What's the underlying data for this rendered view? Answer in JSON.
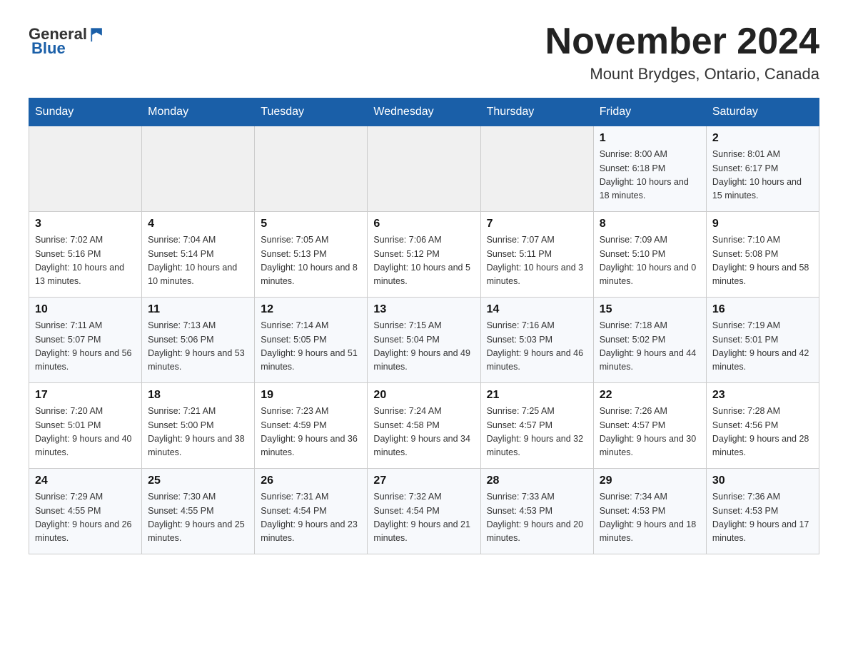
{
  "header": {
    "logo_general": "General",
    "logo_blue": "Blue",
    "title": "November 2024",
    "subtitle": "Mount Brydges, Ontario, Canada"
  },
  "weekdays": [
    "Sunday",
    "Monday",
    "Tuesday",
    "Wednesday",
    "Thursday",
    "Friday",
    "Saturday"
  ],
  "weeks": [
    [
      {
        "day": "",
        "sunrise": "",
        "sunset": "",
        "daylight": ""
      },
      {
        "day": "",
        "sunrise": "",
        "sunset": "",
        "daylight": ""
      },
      {
        "day": "",
        "sunrise": "",
        "sunset": "",
        "daylight": ""
      },
      {
        "day": "",
        "sunrise": "",
        "sunset": "",
        "daylight": ""
      },
      {
        "day": "",
        "sunrise": "",
        "sunset": "",
        "daylight": ""
      },
      {
        "day": "1",
        "sunrise": "Sunrise: 8:00 AM",
        "sunset": "Sunset: 6:18 PM",
        "daylight": "Daylight: 10 hours and 18 minutes."
      },
      {
        "day": "2",
        "sunrise": "Sunrise: 8:01 AM",
        "sunset": "Sunset: 6:17 PM",
        "daylight": "Daylight: 10 hours and 15 minutes."
      }
    ],
    [
      {
        "day": "3",
        "sunrise": "Sunrise: 7:02 AM",
        "sunset": "Sunset: 5:16 PM",
        "daylight": "Daylight: 10 hours and 13 minutes."
      },
      {
        "day": "4",
        "sunrise": "Sunrise: 7:04 AM",
        "sunset": "Sunset: 5:14 PM",
        "daylight": "Daylight: 10 hours and 10 minutes."
      },
      {
        "day": "5",
        "sunrise": "Sunrise: 7:05 AM",
        "sunset": "Sunset: 5:13 PM",
        "daylight": "Daylight: 10 hours and 8 minutes."
      },
      {
        "day": "6",
        "sunrise": "Sunrise: 7:06 AM",
        "sunset": "Sunset: 5:12 PM",
        "daylight": "Daylight: 10 hours and 5 minutes."
      },
      {
        "day": "7",
        "sunrise": "Sunrise: 7:07 AM",
        "sunset": "Sunset: 5:11 PM",
        "daylight": "Daylight: 10 hours and 3 minutes."
      },
      {
        "day": "8",
        "sunrise": "Sunrise: 7:09 AM",
        "sunset": "Sunset: 5:10 PM",
        "daylight": "Daylight: 10 hours and 0 minutes."
      },
      {
        "day": "9",
        "sunrise": "Sunrise: 7:10 AM",
        "sunset": "Sunset: 5:08 PM",
        "daylight": "Daylight: 9 hours and 58 minutes."
      }
    ],
    [
      {
        "day": "10",
        "sunrise": "Sunrise: 7:11 AM",
        "sunset": "Sunset: 5:07 PM",
        "daylight": "Daylight: 9 hours and 56 minutes."
      },
      {
        "day": "11",
        "sunrise": "Sunrise: 7:13 AM",
        "sunset": "Sunset: 5:06 PM",
        "daylight": "Daylight: 9 hours and 53 minutes."
      },
      {
        "day": "12",
        "sunrise": "Sunrise: 7:14 AM",
        "sunset": "Sunset: 5:05 PM",
        "daylight": "Daylight: 9 hours and 51 minutes."
      },
      {
        "day": "13",
        "sunrise": "Sunrise: 7:15 AM",
        "sunset": "Sunset: 5:04 PM",
        "daylight": "Daylight: 9 hours and 49 minutes."
      },
      {
        "day": "14",
        "sunrise": "Sunrise: 7:16 AM",
        "sunset": "Sunset: 5:03 PM",
        "daylight": "Daylight: 9 hours and 46 minutes."
      },
      {
        "day": "15",
        "sunrise": "Sunrise: 7:18 AM",
        "sunset": "Sunset: 5:02 PM",
        "daylight": "Daylight: 9 hours and 44 minutes."
      },
      {
        "day": "16",
        "sunrise": "Sunrise: 7:19 AM",
        "sunset": "Sunset: 5:01 PM",
        "daylight": "Daylight: 9 hours and 42 minutes."
      }
    ],
    [
      {
        "day": "17",
        "sunrise": "Sunrise: 7:20 AM",
        "sunset": "Sunset: 5:01 PM",
        "daylight": "Daylight: 9 hours and 40 minutes."
      },
      {
        "day": "18",
        "sunrise": "Sunrise: 7:21 AM",
        "sunset": "Sunset: 5:00 PM",
        "daylight": "Daylight: 9 hours and 38 minutes."
      },
      {
        "day": "19",
        "sunrise": "Sunrise: 7:23 AM",
        "sunset": "Sunset: 4:59 PM",
        "daylight": "Daylight: 9 hours and 36 minutes."
      },
      {
        "day": "20",
        "sunrise": "Sunrise: 7:24 AM",
        "sunset": "Sunset: 4:58 PM",
        "daylight": "Daylight: 9 hours and 34 minutes."
      },
      {
        "day": "21",
        "sunrise": "Sunrise: 7:25 AM",
        "sunset": "Sunset: 4:57 PM",
        "daylight": "Daylight: 9 hours and 32 minutes."
      },
      {
        "day": "22",
        "sunrise": "Sunrise: 7:26 AM",
        "sunset": "Sunset: 4:57 PM",
        "daylight": "Daylight: 9 hours and 30 minutes."
      },
      {
        "day": "23",
        "sunrise": "Sunrise: 7:28 AM",
        "sunset": "Sunset: 4:56 PM",
        "daylight": "Daylight: 9 hours and 28 minutes."
      }
    ],
    [
      {
        "day": "24",
        "sunrise": "Sunrise: 7:29 AM",
        "sunset": "Sunset: 4:55 PM",
        "daylight": "Daylight: 9 hours and 26 minutes."
      },
      {
        "day": "25",
        "sunrise": "Sunrise: 7:30 AM",
        "sunset": "Sunset: 4:55 PM",
        "daylight": "Daylight: 9 hours and 25 minutes."
      },
      {
        "day": "26",
        "sunrise": "Sunrise: 7:31 AM",
        "sunset": "Sunset: 4:54 PM",
        "daylight": "Daylight: 9 hours and 23 minutes."
      },
      {
        "day": "27",
        "sunrise": "Sunrise: 7:32 AM",
        "sunset": "Sunset: 4:54 PM",
        "daylight": "Daylight: 9 hours and 21 minutes."
      },
      {
        "day": "28",
        "sunrise": "Sunrise: 7:33 AM",
        "sunset": "Sunset: 4:53 PM",
        "daylight": "Daylight: 9 hours and 20 minutes."
      },
      {
        "day": "29",
        "sunrise": "Sunrise: 7:34 AM",
        "sunset": "Sunset: 4:53 PM",
        "daylight": "Daylight: 9 hours and 18 minutes."
      },
      {
        "day": "30",
        "sunrise": "Sunrise: 7:36 AM",
        "sunset": "Sunset: 4:53 PM",
        "daylight": "Daylight: 9 hours and 17 minutes."
      }
    ]
  ]
}
